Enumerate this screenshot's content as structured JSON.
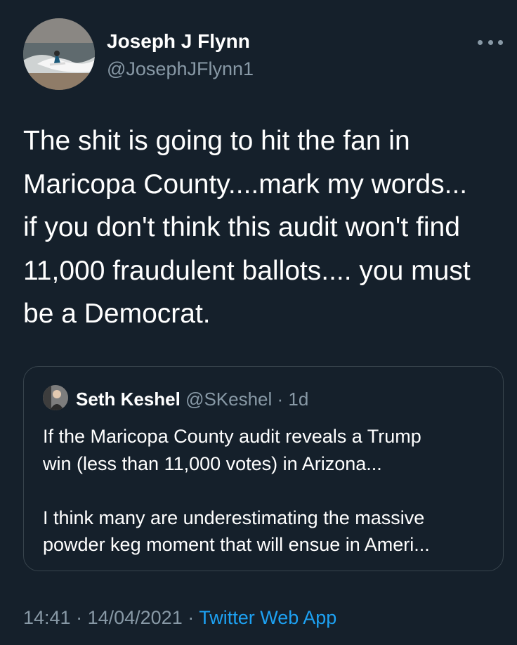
{
  "author": {
    "display_name": "Joseph J Flynn",
    "handle": "@JosephJFlynn1",
    "avatar_icon": "surfer-avatar"
  },
  "more_icon": "more-horizontal-icon",
  "tweet": {
    "lines": [
      "The shit is going to hit the fan in",
      "Maricopa County....mark my words...",
      "if you don't think this audit won't find",
      "11,000 fraudulent ballots.... you must",
      "be a Democrat."
    ]
  },
  "quoted_tweet": {
    "display_name": "Seth Keshel",
    "handle": "@SKeshel",
    "separator": " · ",
    "age": "1d",
    "avatar_icon": "person-avatar",
    "paragraph1": [
      "If the Maricopa County audit reveals a Trump",
      "win (less than 11,000 votes) in Arizona..."
    ],
    "paragraph2": [
      "I think many are underestimating the massive",
      "powder keg moment that will ensue in Ameri..."
    ]
  },
  "footer": {
    "time": "14:41",
    "sep1": " · ",
    "date": "14/04/2021",
    "sep2": " · ",
    "source": "Twitter Web App"
  },
  "colors": {
    "background": "#15202b",
    "text": "#ffffff",
    "secondary": "#8899a6",
    "accent": "#1da1f2",
    "border": "#38444d"
  }
}
